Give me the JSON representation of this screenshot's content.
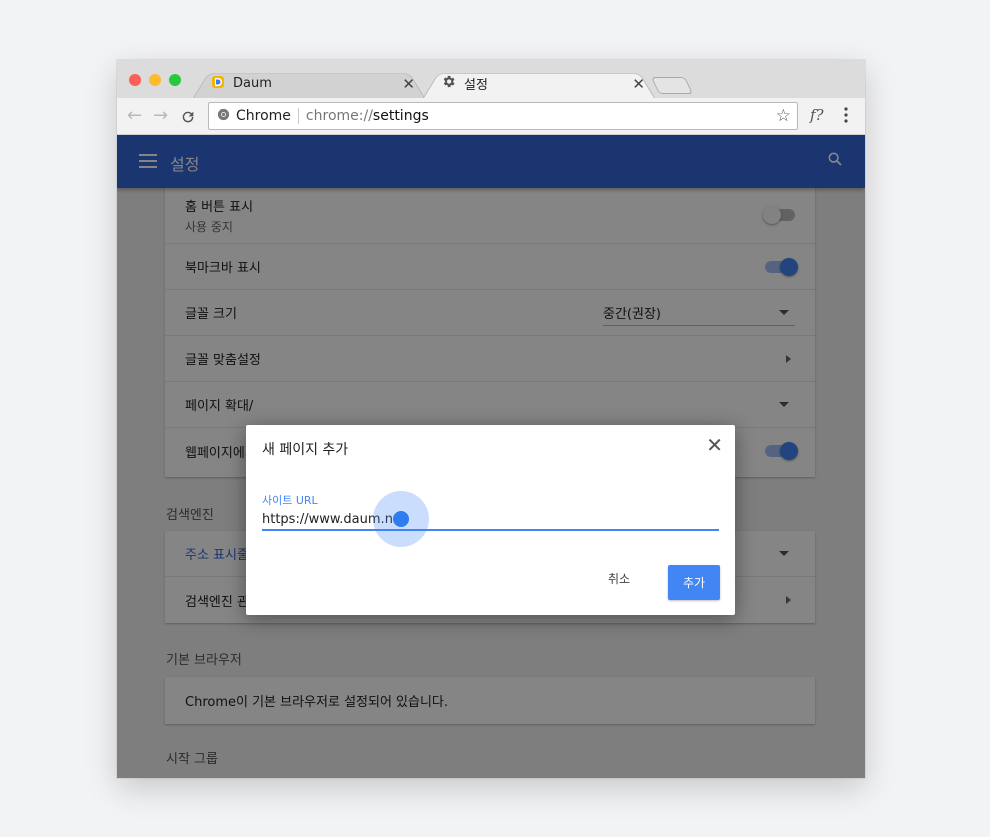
{
  "colors": {
    "traffic_close": "#fc5f57",
    "traffic_minimize": "#fdbc2e",
    "traffic_maximize": "#28c840",
    "accent": "#4285f4",
    "appbar": "#3367d6"
  },
  "tabs": [
    {
      "label": "Daum",
      "icon": "daum-favicon-icon",
      "active": false
    },
    {
      "label": "설정",
      "icon": "gear-icon",
      "active": true
    }
  ],
  "omnibox": {
    "site_label": "Chrome",
    "url_scheme": "chrome://",
    "url_path": "settings"
  },
  "toolbar": {
    "extension_glyph": "f?",
    "icons": [
      "back-icon",
      "forward-icon",
      "reload-icon",
      "bookmark-star-icon",
      "kebab-menu-icon"
    ]
  },
  "appbar": {
    "title": "설정"
  },
  "appearance": {
    "home_button": {
      "label": "홈 버튼 표시",
      "sub": "사용 중지",
      "enabled": false
    },
    "bookmarks_bar": {
      "label": "북마크바 표시",
      "enabled": true
    },
    "font_size": {
      "label": "글꼴 크기",
      "value": "중간(권장)"
    },
    "customize_fonts": {
      "label": "글꼴 맞춤설정"
    },
    "page_zoom": {
      "label": "페이지 확대/"
    },
    "web_row": {
      "label": "웹페이지에서",
      "enabled": true
    }
  },
  "search_engine": {
    "section_title": "검색엔진",
    "address_bar": {
      "label": "주소 표시줄"
    },
    "manage": {
      "label": "검색엔진 관리"
    }
  },
  "default_browser": {
    "section_title": "기본 브라우저",
    "text": "Chrome이 기본 브라우저로 설정되어 있습니다."
  },
  "startup": {
    "section_title": "시작 그룹"
  },
  "dialog": {
    "title": "새 페이지 추가",
    "field_label": "사이트 URL",
    "field_value": "https://www.daum.net",
    "cancel_label": "취소",
    "add_label": "추가"
  }
}
